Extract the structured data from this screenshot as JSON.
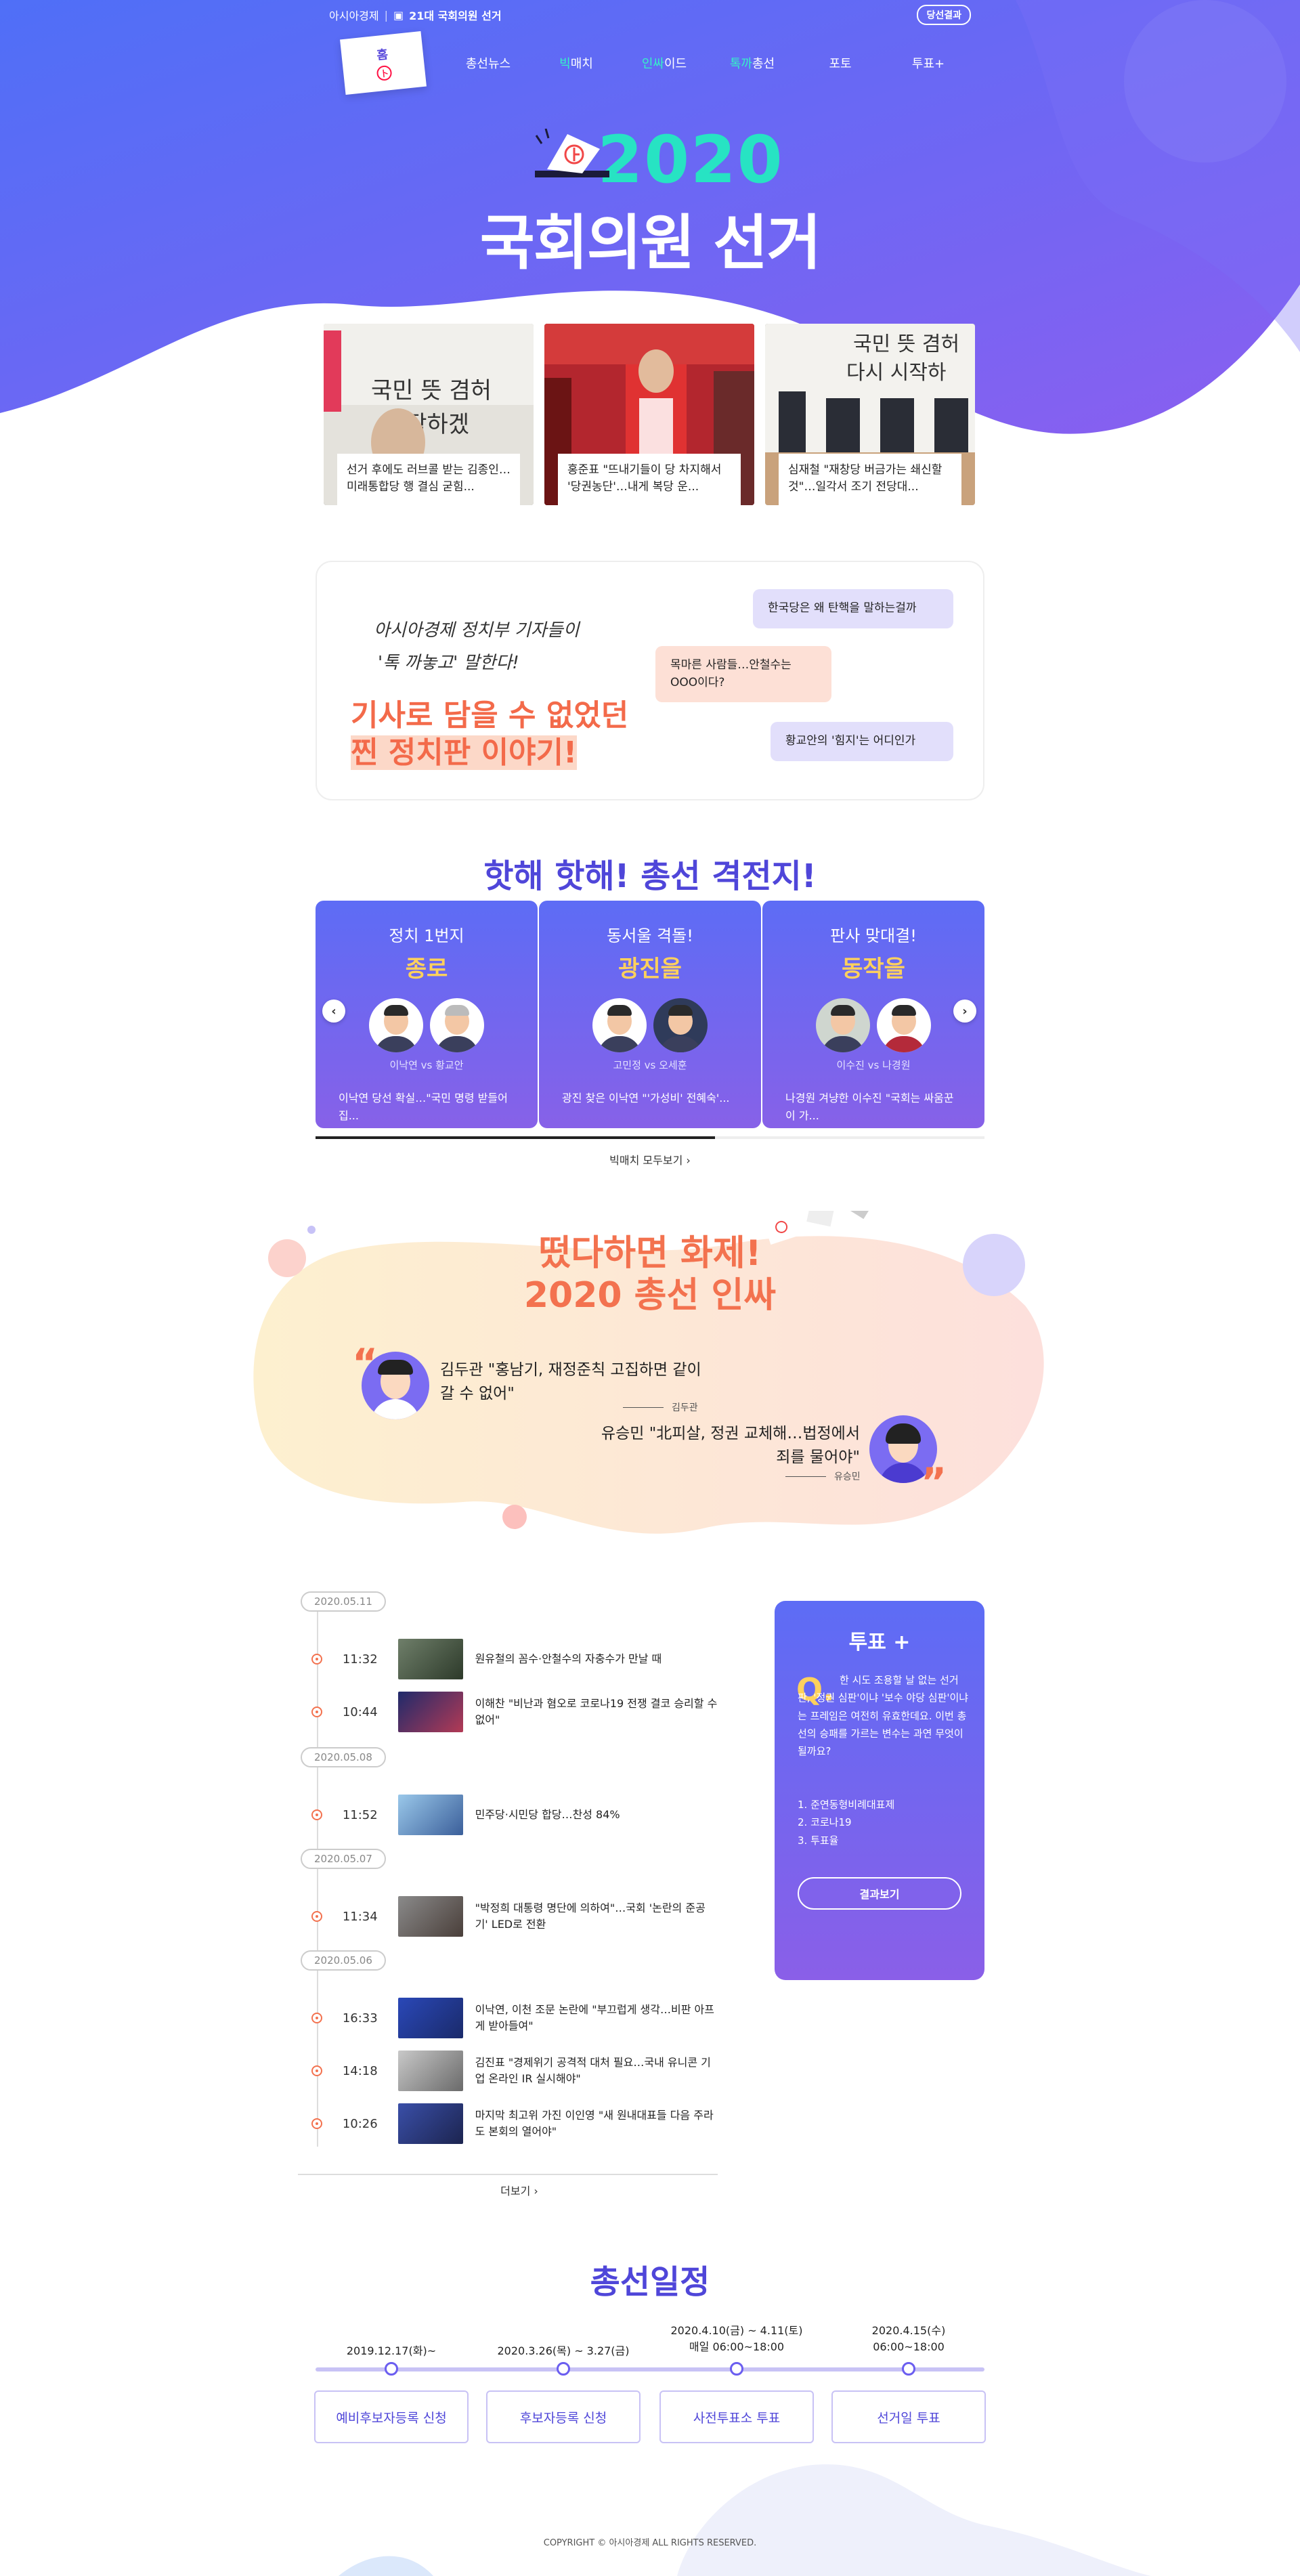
{
  "topbar": {
    "brand": "아시아경제",
    "section": "21대 국회의원 선거",
    "result_button": "당선결과"
  },
  "nav": {
    "home": "홈",
    "items": [
      {
        "label": "총선뉴스"
      },
      {
        "label_hl": "빅",
        "label_rest": "매치"
      },
      {
        "label_hl": "인싸",
        "label_rest": "이드"
      },
      {
        "label_hl": "톡까",
        "label_rest": "총선"
      },
      {
        "label": "포토"
      },
      {
        "label": "투표+"
      }
    ]
  },
  "hero": {
    "year": "2020",
    "title": "국회의원 선거"
  },
  "news_cards": [
    {
      "caption": "선거 후에도 러브콜 받는 김종인…미래통합당 행 결심 굳힘..."
    },
    {
      "caption": "홍준표 \"뜨내기들이 당 차지해서 '당권농단'…내게 복당 운..."
    },
    {
      "caption": "심재철 \"재창당 버금가는 쇄신할 것\"…일각서 조기 전당대..."
    }
  ],
  "talk": {
    "line1": "아시아경제 정치부 기자들이",
    "line2": "'톡 까놓고' 말한다!",
    "big1": "기사로 담을 수 없었던",
    "big2_hl": "찐 정치판",
    "big2_rest": " 이야기!",
    "bubbles": [
      "한국당은 왜 탄핵을 말하는걸까",
      "목마른 사람들…안철수는 OOO이다?",
      "황교안의 '힘지'는 어디인가"
    ]
  },
  "bigmatch": {
    "title": "핫해 핫해! 총선 격전지!",
    "cards": [
      {
        "sub": "정치 1번지",
        "district": "종로",
        "vs": "이낙연 vs 황교안",
        "desc": "이낙연 당선 확실…\"국민 명령 받들어 집..."
      },
      {
        "sub": "동서울 격돌!",
        "district": "광진을",
        "vs": "고민정 vs 오세훈",
        "desc": "광진 찾은 이낙연 \"'가성비' 전혜숙'..."
      },
      {
        "sub": "판사 맞대결!",
        "district": "동작을",
        "vs": "이수진 vs 나경원",
        "desc": "나경원 겨냥한 이수진 \"국회는 싸움꾼이 가..."
      }
    ],
    "more": "빅매치 모두보기"
  },
  "insa": {
    "title1": "떴다하면 화제!",
    "title2": "2020 총선 인싸",
    "quotes": [
      {
        "text": "김두관 \"홍남기, 재정준칙 고집하면 같이 갈 수 없어\"",
        "name": "김두관"
      },
      {
        "text": "유승민 \"北피살, 정권 교체해…법정에서 죄를 물어야\"",
        "name": "유승민"
      }
    ]
  },
  "timeline": {
    "groups": [
      {
        "date": "2020.05.11",
        "items": [
          {
            "time": "11:32",
            "text": "원유철의 꼼수·안철수의 자충수가 만날 때"
          },
          {
            "time": "10:44",
            "text": "이해찬 \"비난과 혐오로 코로나19 전쟁 결코 승리할 수 없어\""
          }
        ]
      },
      {
        "date": "2020.05.08",
        "items": [
          {
            "time": "11:52",
            "text": "민주당·시민당 합당…찬성 84%"
          }
        ]
      },
      {
        "date": "2020.05.07",
        "items": [
          {
            "time": "11:34",
            "text": "\"박정희 대통령 명단에 의하여\"…국회 '논란의 준공기' LED로 전환"
          }
        ]
      },
      {
        "date": "2020.05.06",
        "items": [
          {
            "time": "16:33",
            "text": "이낙연, 이천 조문 논란에 \"부끄럽게 생각…비판 아프게 받아들여\""
          },
          {
            "time": "14:18",
            "text": "김진표 \"경제위기 공격적 대처 필요…국내 유니콘 기업 온라인 IR 실시해야\""
          },
          {
            "time": "10:26",
            "text": "마지막 최고위 가진 이인영 \"새 원내대표들 다음 주라도 본회의 열어야\""
          }
        ]
      }
    ],
    "more": "더보기"
  },
  "vote": {
    "title": "투표 +",
    "q": "Q.",
    "question": "한 시도 조용할 날 없는 선거판, '정권 심판'이냐 '보수 야당 심판'이냐는 프레임은 여전히 유효한데요. 이번 총선의 승패를 가르는 변수는 과연 무엇이 될까요?",
    "options": [
      "1. 준연동형비례대표제",
      "2. 코로나19",
      "3. 투표율"
    ],
    "button": "결과보기"
  },
  "schedule": {
    "title": "총선일정",
    "items": [
      {
        "date1": "2019.12.17(화)~",
        "date2": "",
        "label": "예비후보자등록 신청"
      },
      {
        "date1": "2020.3.26(목) ~ 3.27(금)",
        "date2": "",
        "label": "후보자등록 신청"
      },
      {
        "date1": "2020.4.10(금) ~ 4.11(토)",
        "date2": "매일 06:00~18:00",
        "label": "사전투표소 투표"
      },
      {
        "date1": "2020.4.15(수)",
        "date2": "06:00~18:00",
        "label": "선거일 투표"
      }
    ]
  },
  "footer": {
    "copyright": "COPYRIGHT © 아시아경제 ALL RIGHTS RESERVED."
  }
}
